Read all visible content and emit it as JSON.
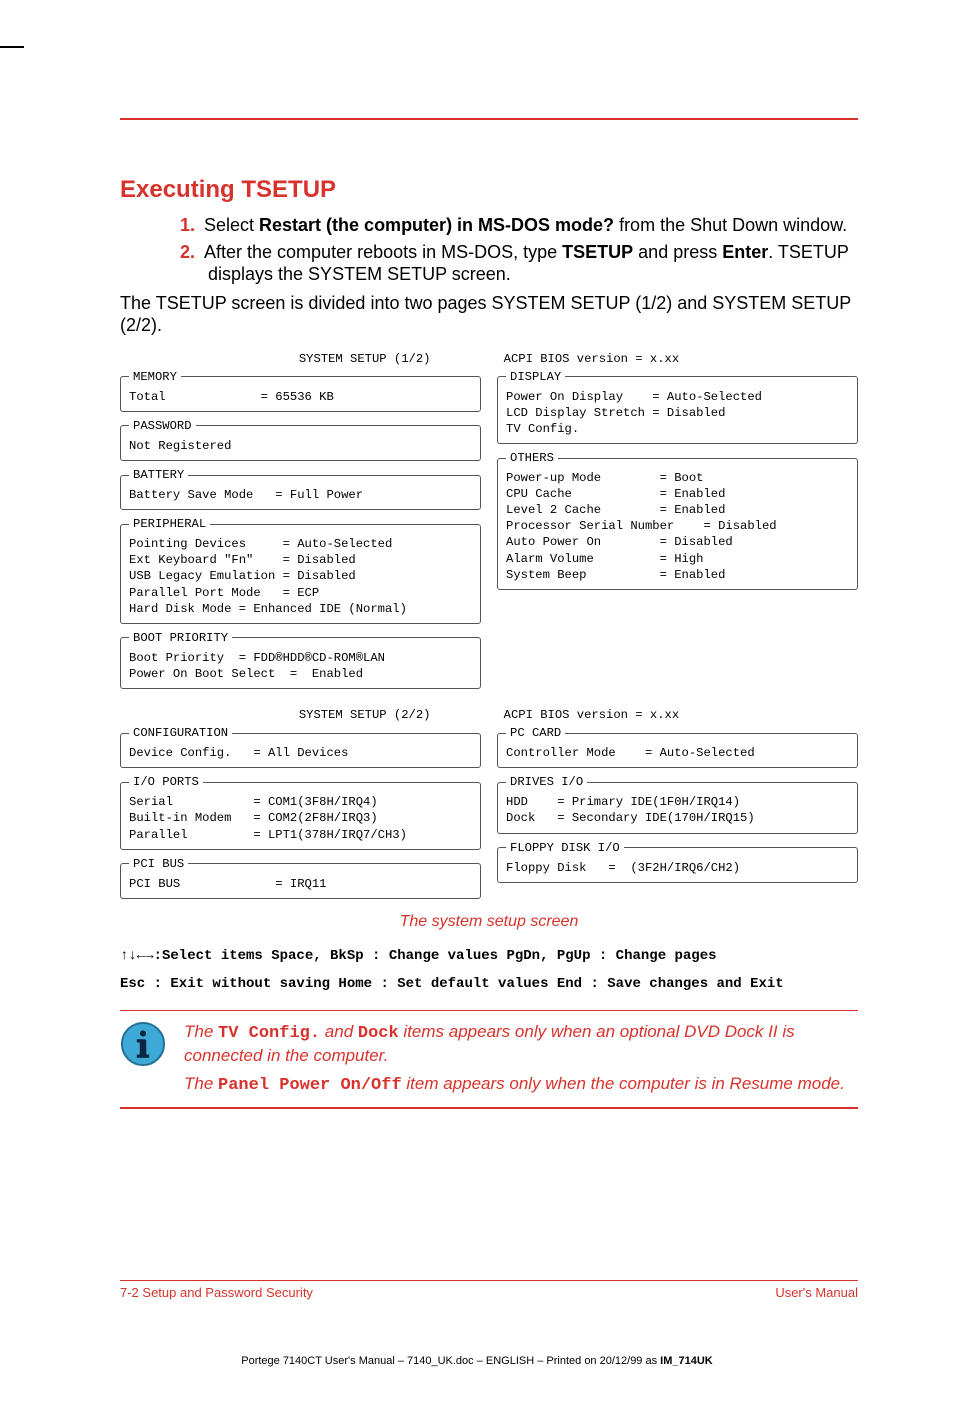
{
  "heading": "Executing TSETUP",
  "steps": [
    {
      "num": "1.",
      "pre": "Select ",
      "bold1": "Restart (the computer) in MS-DOS mode?",
      "post": " from the Shut Down window."
    },
    {
      "num": "2.",
      "pre": "After the computer reboots in MS-DOS, type ",
      "bold1": "TSETUP",
      "mid": " and press ",
      "bold2": "Enter",
      "post": ". TSETUP displays the SYSTEM SETUP screen."
    }
  ],
  "intro_para": "The TSETUP screen is divided into two pages SYSTEM SETUP (1/2) and SYSTEM SETUP (2/2).",
  "screen1": {
    "header": "SYSTEM SETUP (1/2)          ACPI BIOS version = x.xx",
    "left": {
      "memory": {
        "legend": "MEMORY",
        "lines": [
          "Total             = 65536 KB"
        ]
      },
      "password": {
        "legend": "PASSWORD",
        "lines": [
          "Not Registered"
        ]
      },
      "battery": {
        "legend": "BATTERY",
        "lines": [
          "Battery Save Mode   = Full Power"
        ]
      },
      "peripheral": {
        "legend": "PERIPHERAL",
        "lines": [
          "Pointing Devices     = Auto-Selected",
          "Ext Keyboard \"Fn\"    = Disabled",
          "USB Legacy Emulation = Disabled",
          "Parallel Port Mode   = ECP",
          "Hard Disk Mode = Enhanced IDE (Normal)"
        ]
      },
      "boot": {
        "legend": "BOOT PRIORITY",
        "lines": [
          "Boot Priority  = FDD®HDD®CD-ROM®LAN",
          "Power On Boot Select  =  Enabled"
        ]
      }
    },
    "right": {
      "display": {
        "legend": "DISPLAY",
        "lines": [
          "Power On Display    = Auto-Selected",
          "LCD Display Stretch = Disabled",
          "TV Config."
        ]
      },
      "others": {
        "legend": "OTHERS",
        "lines": [
          "Power-up Mode        = Boot",
          "CPU Cache            = Enabled",
          "Level 2 Cache        = Enabled",
          "Processor Serial Number    = Disabled",
          "Auto Power On        = Disabled",
          "Alarm Volume         = High",
          "System Beep          = Enabled"
        ]
      }
    }
  },
  "screen2": {
    "header": "SYSTEM SETUP (2/2)          ACPI BIOS version = x.xx",
    "left": {
      "config": {
        "legend": "CONFIGURATION",
        "lines": [
          "Device Config.   = All Devices"
        ]
      },
      "ioports": {
        "legend": "I/O PORTS",
        "lines": [
          "Serial           = COM1(3F8H/IRQ4)",
          "Built-in Modem   = COM2(2F8H/IRQ3)",
          "Parallel         = LPT1(378H/IRQ7/CH3)"
        ]
      },
      "pcibus": {
        "legend": "PCI BUS",
        "lines": [
          "PCI BUS             = IRQ11"
        ]
      }
    },
    "right": {
      "pccard": {
        "legend": "PC CARD",
        "lines": [
          "Controller Mode    = Auto-Selected"
        ]
      },
      "drives": {
        "legend": "DRIVES I/O",
        "lines": [
          "HDD    = Primary IDE(1F0H/IRQ14)",
          "Dock   = Secondary IDE(170H/IRQ15)"
        ]
      },
      "floppy": {
        "legend": "FLOPPY DISK I/O",
        "lines": [
          "Floppy Disk   =  (3F2H/IRQ6/CH2)"
        ]
      }
    }
  },
  "caption": "The system setup screen",
  "keyhelp": {
    "line1": "↑↓←→:Select items  Space, BkSp : Change values    PgDn, PgUp : Change pages",
    "line2": "Esc : Exit without saving Home : Set default values End : Save changes and Exit"
  },
  "note": {
    "p1_pre": "The ",
    "p1_code1": "TV Config.",
    "p1_mid1": " and ",
    "p1_code2": "Dock",
    "p1_post": " items appears only when an optional DVD Dock II is connected in the computer.",
    "p2_pre": "The ",
    "p2_code": "Panel Power On/Off",
    "p2_post": " item appears only when the computer is in Resume mode."
  },
  "footer": {
    "left": "7-2  Setup and Password Security",
    "right": "User's Manual"
  },
  "imprint": "Portege 7140CT User's Manual  – 7140_UK.doc – ENGLISH – Printed on 20/12/99 as IM_714UK"
}
